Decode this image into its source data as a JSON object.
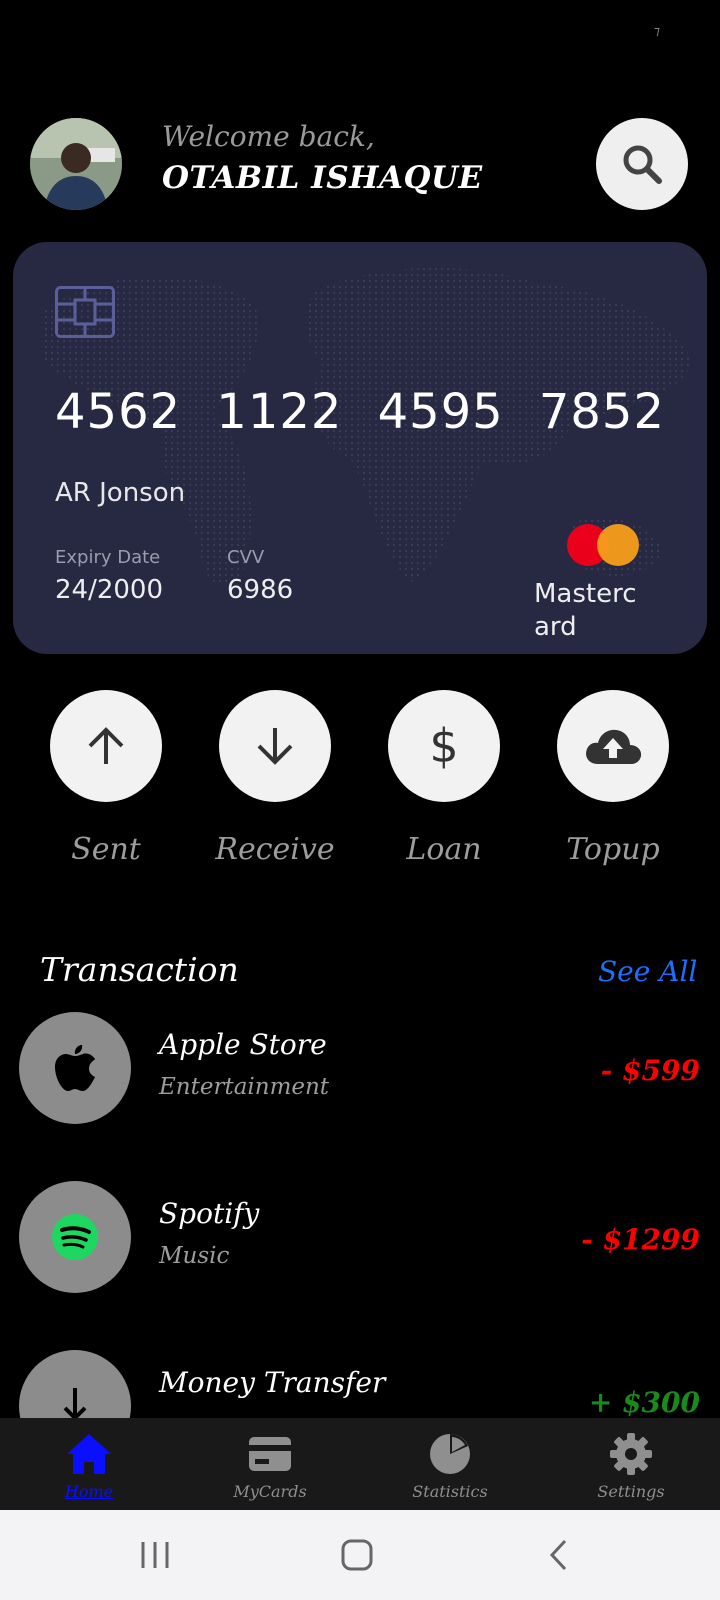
{
  "status_bar": {
    "indicator": "⁊"
  },
  "header": {
    "welcome": "Welcome back,",
    "username": "OTABIL ISHAQUE",
    "avatar_icon": "user-photo",
    "search_icon": "search-icon"
  },
  "card": {
    "number_groups": [
      "4562",
      "1122",
      "4595",
      "7852"
    ],
    "holder": "AR Jonson",
    "expiry_label": "Expiry Date",
    "expiry_value": "24/2000",
    "cvv_label": "CVV",
    "cvv_value": "6986",
    "brand": "Mastercard",
    "background_color": "#272842"
  },
  "actions": [
    {
      "label": "Sent",
      "icon": "arrow-up-icon"
    },
    {
      "label": "Receive",
      "icon": "arrow-down-icon"
    },
    {
      "label": "Loan",
      "icon": "dollar-icon"
    },
    {
      "label": "Topup",
      "icon": "cloud-upload-icon"
    }
  ],
  "transactions": {
    "title": "Transaction",
    "see_all": "See All",
    "items": [
      {
        "name": "Apple Store",
        "category": "Entertainment",
        "amount": "- $599",
        "color": "#ff0000",
        "icon": "apple-icon"
      },
      {
        "name": "Spotify",
        "category": "Music",
        "amount": "- $1299",
        "color": "#ff0000",
        "icon": "spotify-icon"
      },
      {
        "name": "Money Transfer",
        "category": "",
        "amount": "+ $300",
        "color": "#1a8a1a",
        "icon": "download-icon"
      }
    ]
  },
  "bottom_nav": [
    {
      "label": "Home",
      "icon": "home-icon",
      "active": true
    },
    {
      "label": "MyCards",
      "icon": "card-icon",
      "active": false
    },
    {
      "label": "Statistics",
      "icon": "pie-chart-icon",
      "active": false
    },
    {
      "label": "Settings",
      "icon": "gear-icon",
      "active": false
    }
  ],
  "colors": {
    "accent_blue": "#1f6fff",
    "nav_active": "#0a10ff",
    "negative": "#ff0000",
    "positive": "#1a8a1a"
  }
}
